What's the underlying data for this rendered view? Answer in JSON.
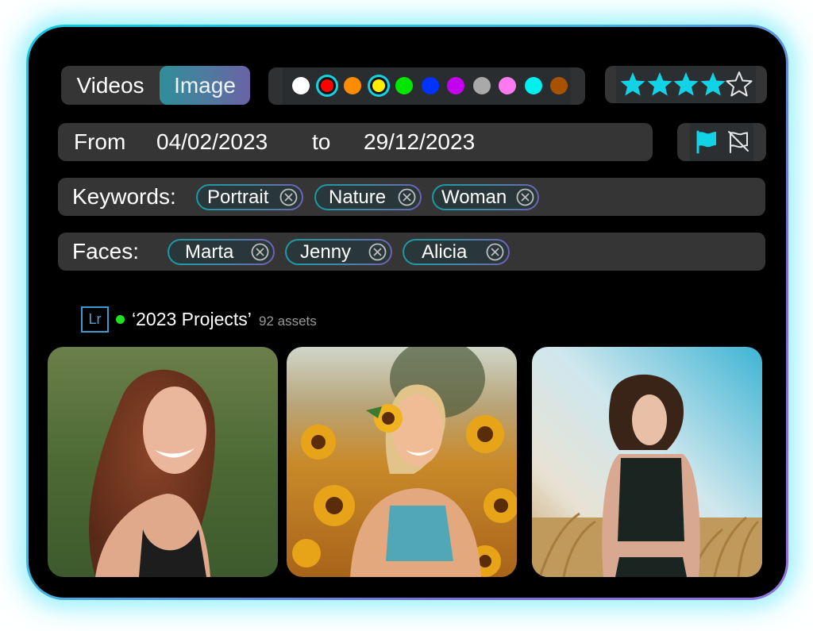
{
  "media_toggle": {
    "options": [
      {
        "label": "Videos",
        "selected": false
      },
      {
        "label": "Image",
        "selected": true
      }
    ]
  },
  "color_filter": {
    "colors": [
      {
        "name": "white",
        "hex": "#ffffff",
        "selected": false
      },
      {
        "name": "red",
        "hex": "#ff0000",
        "selected": true
      },
      {
        "name": "orange",
        "hex": "#ff8c00",
        "selected": false
      },
      {
        "name": "yellow",
        "hex": "#ffee00",
        "selected": true
      },
      {
        "name": "green",
        "hex": "#00e600",
        "selected": false
      },
      {
        "name": "blue",
        "hex": "#0033ff",
        "selected": false
      },
      {
        "name": "purple",
        "hex": "#c300f0",
        "selected": false
      },
      {
        "name": "gray",
        "hex": "#a9a9a9",
        "selected": false
      },
      {
        "name": "pink",
        "hex": "#ff7af0",
        "selected": false
      },
      {
        "name": "cyan",
        "hex": "#00f0f0",
        "selected": false
      },
      {
        "name": "brown",
        "hex": "#a85200",
        "selected": false
      }
    ],
    "selected_ring_color": "#12d3e6"
  },
  "rating": {
    "value": 4,
    "max": 5,
    "filled_color": "#12d3e6",
    "empty_color": "#e6e6e6"
  },
  "date_range": {
    "from_label": "From",
    "from_value": "04/02/2023",
    "to_label": "to",
    "to_value": "29/12/2023"
  },
  "flags": {
    "flagged": {
      "icon": "flag-icon",
      "active": true,
      "color": "#12d3e6"
    },
    "unflagged": {
      "icon": "flag-off-icon",
      "active": false,
      "color": "#e6e6e6"
    }
  },
  "keywords": {
    "label": "Keywords:",
    "chips": [
      "Portrait",
      "Nature",
      "Woman"
    ]
  },
  "faces": {
    "label": "Faces:",
    "chips": [
      "Marta",
      "Jenny",
      "Alicia"
    ]
  },
  "collection": {
    "app_icon_text": "Lr",
    "status_color": "#22e022",
    "name": "‘2023 Projects’",
    "count": "92 assets"
  },
  "photos": [
    {
      "subject": "smiling woman with long auburn hair in green meadow"
    },
    {
      "subject": "blonde woman with sunflower in hair in sunflower field"
    },
    {
      "subject": "woman with short dark hair in black top in wheat field"
    }
  ]
}
